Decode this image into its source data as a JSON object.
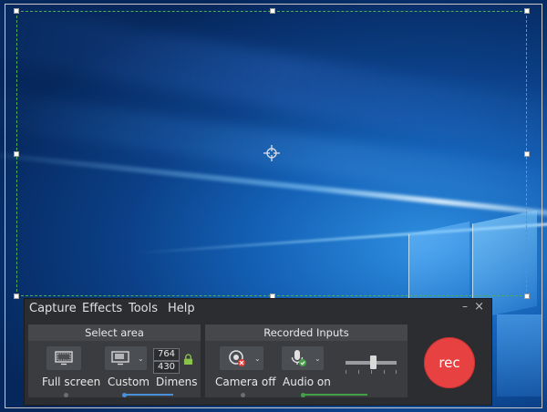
{
  "menu": {
    "capture": "Capture",
    "effects": "Effects",
    "tools": "Tools",
    "help": "Help"
  },
  "window_controls": {
    "minimize": "–",
    "close": "×"
  },
  "select_area": {
    "title": "Select area",
    "full_screen_label": "Full screen",
    "custom_label": "Custom",
    "dimensions_label": "Dimens",
    "width_value": "764",
    "height_value": "430"
  },
  "recorded_inputs": {
    "title": "Recorded Inputs",
    "camera_label": "Camera off",
    "audio_label": "Audio on",
    "volume_level": 0.55
  },
  "record_button": {
    "label": "rec"
  },
  "colors": {
    "selection_border": "#4caf50",
    "record_button": "#e84141",
    "custom_underline": "#4a90d9",
    "audio_underline": "#43a047",
    "toolbar_bg": "#2b2d30"
  }
}
